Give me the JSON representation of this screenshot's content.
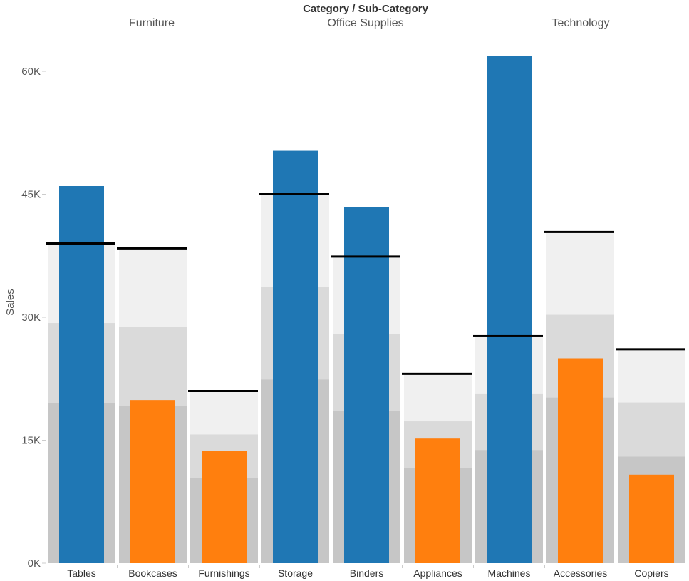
{
  "chart_data": {
    "type": "bar",
    "subtype": "bullet",
    "title": "Category  /  Sub-Category",
    "xlabel": "",
    "ylabel": "Sales",
    "ylim": [
      0,
      62000
    ],
    "yticks": [
      0,
      15000,
      30000,
      45000,
      60000
    ],
    "ytick_labels": [
      "0K",
      "15K",
      "30K",
      "45K",
      "60K"
    ],
    "grid": false,
    "groups": [
      {
        "name": "Furniture",
        "categories": [
          "Tables",
          "Bookcases",
          "Furnishings"
        ]
      },
      {
        "name": "Office Supplies",
        "categories": [
          "Storage",
          "Binders",
          "Appliances"
        ]
      },
      {
        "name": "Technology",
        "categories": [
          "Machines",
          "Accessories",
          "Copiers"
        ]
      }
    ],
    "categories": [
      "Tables",
      "Bookcases",
      "Furnishings",
      "Storage",
      "Binders",
      "Appliances",
      "Machines",
      "Accessories",
      "Copiers"
    ],
    "series": [
      {
        "name": "Sales",
        "values": [
          46000,
          19900,
          13700,
          50300,
          43400,
          15200,
          61900,
          25000,
          10800
        ]
      },
      {
        "name": "Target",
        "values": [
          39000,
          38400,
          21000,
          45000,
          37400,
          23100,
          27700,
          40400,
          26100
        ]
      },
      {
        "name": "Band 100%",
        "values": [
          39000,
          38400,
          21000,
          45000,
          37400,
          23100,
          27700,
          40400,
          26100
        ]
      },
      {
        "name": "Band 75%",
        "values": [
          29300,
          28800,
          15700,
          33700,
          28000,
          17300,
          20700,
          30300,
          19600
        ]
      },
      {
        "name": "Band 50%",
        "values": [
          19500,
          19200,
          10400,
          22400,
          18600,
          11600,
          13800,
          20200,
          13000
        ]
      }
    ],
    "bar_color_rule": "blue when Sales exceeds Target, orange otherwise",
    "colors": {
      "above_target": "#1f77b4",
      "below_target": "#ff7f0e",
      "band_light": "#f0f0f0",
      "band_mid": "#dadada",
      "band_dark": "#c6c6c6",
      "target_line": "#000000",
      "axis_text": "#555555"
    }
  }
}
